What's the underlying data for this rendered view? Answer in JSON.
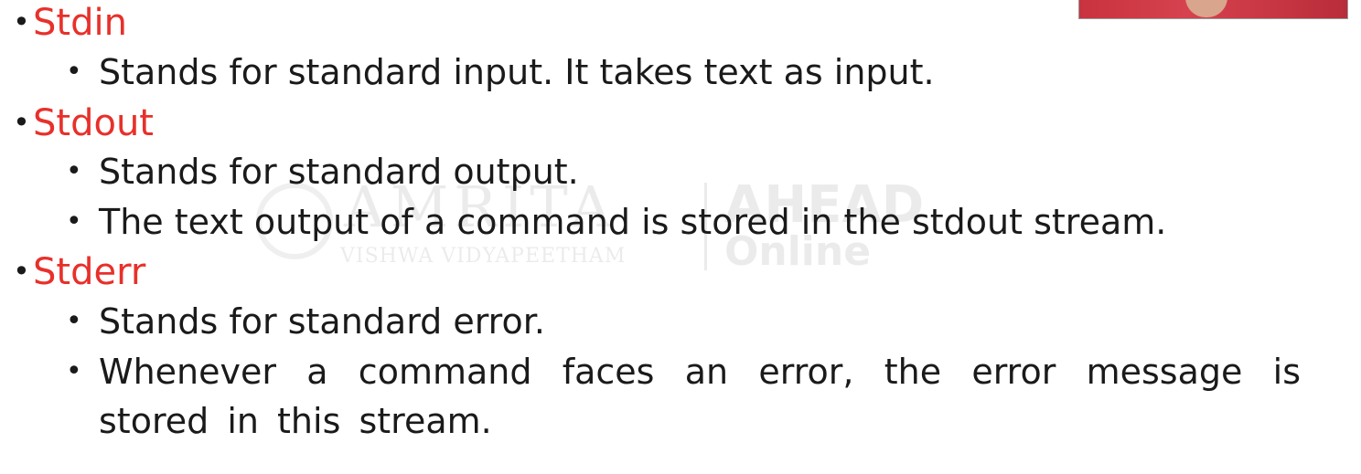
{
  "watermark": {
    "brand": "AMRITA",
    "subtitle": "VISHWA VIDYAPEETHAM",
    "ahead": "AHEAD",
    "online": "Online"
  },
  "bullet_glyph": "•",
  "sections": [
    {
      "heading": "Stdin",
      "points": [
        "Stands for standard input. It takes text as input."
      ]
    },
    {
      "heading": "Stdout",
      "points": [
        "Stands for standard output.",
        "The text output of a command is stored in the stdout stream."
      ]
    },
    {
      "heading": "Stderr",
      "points": [
        "Stands for standard error.",
        "Whenever a command faces an error, the error message is stored in this stream."
      ]
    }
  ],
  "colors": {
    "heading": "#e8302a",
    "body": "#1a1a1a",
    "background": "#ffffff"
  }
}
